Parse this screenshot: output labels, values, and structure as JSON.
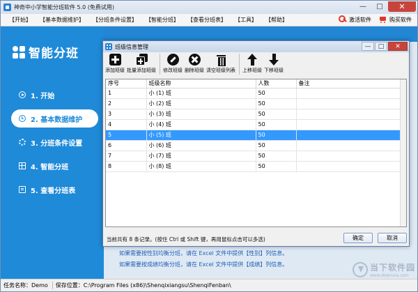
{
  "window": {
    "title": "神奇中小学智能分班软件 5.0 (免费试用)",
    "minimize": "—",
    "maximize": "□",
    "close": "✕"
  },
  "menu": {
    "items": [
      "【开始】",
      "【基本数据维护】",
      "【分班条件设置】",
      "【智能分班】",
      "【查看分班表】",
      "【工具】",
      "【帮助】"
    ],
    "activate": "激活软件",
    "buy": "购买软件"
  },
  "sidebar": {
    "brand": "智能分班",
    "items": [
      {
        "label": "1. 开始",
        "icon": "play-icon"
      },
      {
        "label": "2. 基本数据维护",
        "icon": "clock-icon"
      },
      {
        "label": "3. 分班条件设置",
        "icon": "gear-icon"
      },
      {
        "label": "4. 智能分班",
        "icon": "grid-icon"
      },
      {
        "label": "5. 查看分班表",
        "icon": "list-icon"
      }
    ],
    "active_index": 1
  },
  "colors": {
    "sidebar": "#1f8ad8",
    "selected_row": "#3399ff",
    "close_button": "#c8443a"
  },
  "background_hints": {
    "line1": "如果需要按性别均衡分班，请在 Excel 文件中提供【性别】列信息。",
    "line2": "如果需要按成绩均衡分班，请在 Excel 文件中提供【成绩】列信息。"
  },
  "status": {
    "task": "任务名称：Demo",
    "path": "保存位置：C:\\Program Files (x86)\\Shenqixiangsu\\ShenqiFenban\\"
  },
  "dialog": {
    "title": "班级信息管理",
    "toolbar": [
      {
        "label": "添加班级",
        "icon": "add-icon"
      },
      {
        "label": "批量添加班级",
        "icon": "batch-add-icon"
      },
      {
        "label": "修改班级",
        "icon": "edit-icon"
      },
      {
        "label": "删除班级",
        "icon": "delete-icon"
      },
      {
        "label": "清空班级列表",
        "icon": "trash-icon"
      },
      {
        "label": "上移班级",
        "icon": "arrow-up-icon"
      },
      {
        "label": "下移班级",
        "icon": "arrow-down-icon"
      }
    ],
    "columns": [
      "序号",
      "班级名称",
      "人数",
      "备注"
    ],
    "rows": [
      [
        "1",
        "小 (1) 班",
        "50",
        ""
      ],
      [
        "2",
        "小 (2) 班",
        "50",
        ""
      ],
      [
        "3",
        "小 (3) 班",
        "50",
        ""
      ],
      [
        "4",
        "小 (4) 班",
        "50",
        ""
      ],
      [
        "5",
        "小 (5) 班",
        "50",
        ""
      ],
      [
        "6",
        "小 (6) 班",
        "50",
        ""
      ],
      [
        "7",
        "小 (7) 班",
        "50",
        ""
      ],
      [
        "8",
        "小 (8) 班",
        "50",
        ""
      ]
    ],
    "selected_row": 4,
    "footer": "当前共有 8 条记录。(按住 Ctrl 或 Shift 键，再用鼠标点击可以多选)",
    "ok": "确定",
    "cancel": "取消"
  },
  "watermark": {
    "cn": "当下软件园",
    "en": "www.downxia.com"
  }
}
